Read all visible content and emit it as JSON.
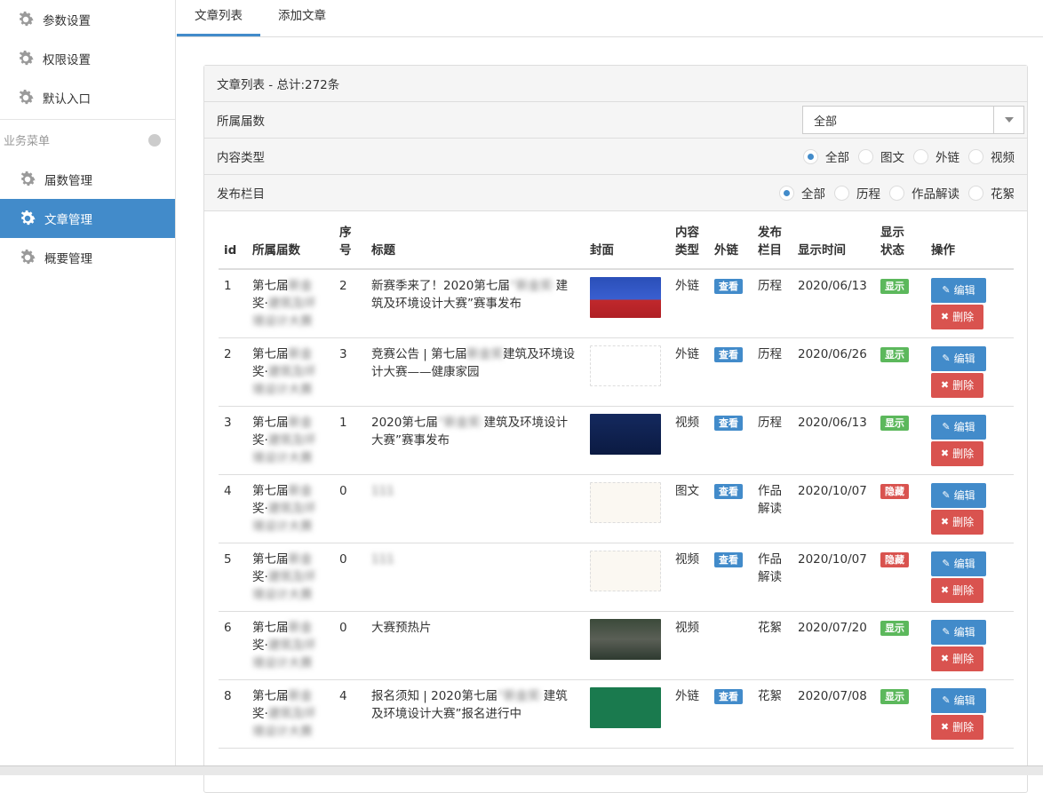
{
  "sidebar": {
    "items_top": [
      {
        "label": "参数设置",
        "icon": "gear-icon"
      },
      {
        "label": "权限设置",
        "icon": "gear-icon"
      },
      {
        "label": "默认入口",
        "icon": "gear-icon"
      }
    ],
    "group_label": "业务菜单",
    "items_biz": [
      {
        "label": "届数管理",
        "icon": "gear-icon"
      },
      {
        "label": "文章管理",
        "icon": "gear-icon",
        "active": true
      },
      {
        "label": "概要管理",
        "icon": "gear-icon"
      }
    ]
  },
  "tabs": [
    {
      "label": "文章列表",
      "active": true
    },
    {
      "label": "添加文章",
      "active": false
    }
  ],
  "panel": {
    "title": "文章列表 - 总计:272条",
    "filter_session_label": "所属届数",
    "filter_session_value": "全部",
    "filter_type_label": "内容类型",
    "filter_type_options": [
      "全部",
      "图文",
      "外链",
      "视频"
    ],
    "filter_column_label": "发布栏目",
    "filter_column_options": [
      "全部",
      "历程",
      "作品解读",
      "花絮"
    ]
  },
  "table": {
    "headers": {
      "id": "id",
      "session": "所属届数",
      "order_1": "序",
      "order_2": "号",
      "title": "标题",
      "cover": "封面",
      "type_1": "内容",
      "type_2": "类型",
      "link": "外链",
      "column_1": "发布",
      "column_2": "栏目",
      "time": "显示时间",
      "status_1": "显示",
      "status_2": "状态",
      "ops": "操作"
    },
    "view_label": "查看",
    "edit_label": "编辑",
    "delete_label": "删除",
    "rows": [
      {
        "id": "1",
        "session_a": "第七届",
        "session_b": "新金",
        "session_c": "奖·",
        "session_d": "建筑及环",
        "session_e": "境设计大赛",
        "order": "2",
        "title_a": "新赛季来了！2020第七届",
        "title_b": "“新金奖·",
        "title_c": "建筑及环境设计大赛”赛事发布",
        "type": "外链",
        "has_link": true,
        "column": "历程",
        "time": "2020/06/13",
        "status": "显示"
      },
      {
        "id": "2",
        "session_a": "第七届",
        "session_b": "新金",
        "session_c": "奖·",
        "session_d": "建筑及环",
        "session_e": "境设计大赛",
        "order": "3",
        "title_a": "竞赛公告 | 第七届",
        "title_b": "新金奖",
        "title_c": "建筑及环境设计大赛——健康家园",
        "type": "外链",
        "has_link": true,
        "column": "历程",
        "time": "2020/06/26",
        "status": "显示"
      },
      {
        "id": "3",
        "session_a": "第七届",
        "session_b": "新金",
        "session_c": "奖·",
        "session_d": "建筑及环",
        "session_e": "境设计大赛",
        "order": "1",
        "title_a": "2020第七届",
        "title_b": "“新金奖·",
        "title_c": "建筑及环境设计大赛”赛事发布",
        "type": "视频",
        "has_link": true,
        "column": "历程",
        "time": "2020/06/13",
        "status": "显示"
      },
      {
        "id": "4",
        "session_a": "第七届",
        "session_b": "新金",
        "session_c": "奖·",
        "session_d": "建筑及环",
        "session_e": "境设计大赛",
        "order": "0",
        "title_a": "",
        "title_b": "111",
        "title_c": "",
        "type": "图文",
        "has_link": true,
        "column": "作品解读",
        "time": "2020/10/07",
        "status": "隐藏"
      },
      {
        "id": "5",
        "session_a": "第七届",
        "session_b": "新金",
        "session_c": "奖·",
        "session_d": "建筑及环",
        "session_e": "境设计大赛",
        "order": "0",
        "title_a": "",
        "title_b": "111",
        "title_c": "",
        "type": "视频",
        "has_link": true,
        "column": "作品解读",
        "time": "2020/10/07",
        "status": "隐藏"
      },
      {
        "id": "6",
        "session_a": "第七届",
        "session_b": "新金",
        "session_c": "奖·",
        "session_d": "建筑及环",
        "session_e": "境设计大赛",
        "order": "0",
        "title_a": "大赛预热片",
        "title_b": "",
        "title_c": "",
        "type": "视频",
        "has_link": false,
        "column": "花絮",
        "time": "2020/07/20",
        "status": "显示"
      },
      {
        "id": "8",
        "session_a": "第七届",
        "session_b": "新金",
        "session_c": "奖·",
        "session_d": "建筑及环",
        "session_e": "境设计大赛",
        "order": "4",
        "title_a": "报名须知 | 2020第七届",
        "title_b": "“新金奖·",
        "title_c": "建筑及环境设计大赛”报名进行中",
        "type": "外链",
        "has_link": true,
        "column": "花絮",
        "time": "2020/07/08",
        "status": "显示"
      }
    ]
  },
  "colors": {
    "primary": "#428bca",
    "success": "#5cb85c",
    "danger": "#d9534f"
  }
}
